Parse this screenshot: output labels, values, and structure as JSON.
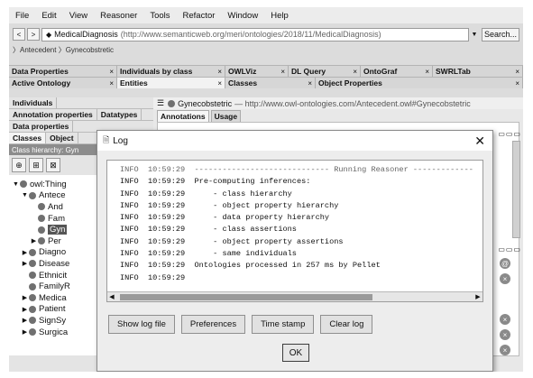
{
  "menubar": [
    "File",
    "Edit",
    "View",
    "Reasoner",
    "Tools",
    "Refactor",
    "Window",
    "Help"
  ],
  "address": {
    "back": "<",
    "forward": ">",
    "ontology_name": "MedicalDiagnosis",
    "ontology_uri": "(http://www.semanticweb.org/meri/ontologies/2018/11/MedicalDiagnosis)",
    "dropdown": "▼",
    "search_label": "Search..."
  },
  "breadcrumb": "〉Antecedent 〉Gynecobstretic",
  "tabs_row1": [
    {
      "label": "Data Properties",
      "close": "×"
    },
    {
      "label": "Individuals by class",
      "close": "×"
    },
    {
      "label": "OWLViz",
      "close": "×"
    },
    {
      "label": "DL Query",
      "close": "×"
    },
    {
      "label": "OntoGraf",
      "close": "×"
    },
    {
      "label": "SWRLTab",
      "close": "×"
    }
  ],
  "tabs_row2": [
    {
      "label": "Active Ontology",
      "close": "×"
    },
    {
      "label": "Entities",
      "close": "×"
    },
    {
      "label": "Classes",
      "close": "×"
    },
    {
      "label": "Object Properties",
      "close": "×"
    }
  ],
  "left": {
    "row1": [
      "Individuals"
    ],
    "row2": [
      "Annotation properties",
      "Datatypes"
    ],
    "row3": [
      "Data properties"
    ],
    "row4": [
      "Classes",
      "Object"
    ],
    "hierarchy_label": "Class hierarchy: Gyn",
    "tree": [
      {
        "toggle": "▼",
        "label": "owl:Thing",
        "indent": 0
      },
      {
        "toggle": "▼",
        "label": "Antece",
        "indent": 1
      },
      {
        "toggle": "",
        "label": "And",
        "indent": 2
      },
      {
        "toggle": "",
        "label": "Fam",
        "indent": 2
      },
      {
        "toggle": "",
        "label": "Gyn",
        "indent": 2,
        "selected": true
      },
      {
        "toggle": "▶",
        "label": "Per",
        "indent": 2
      },
      {
        "toggle": "▶",
        "label": "Diagno",
        "indent": 1
      },
      {
        "toggle": "▶",
        "label": "Disease",
        "indent": 1
      },
      {
        "toggle": "",
        "label": "Ethnicit",
        "indent": 1
      },
      {
        "toggle": "",
        "label": "FamilyR",
        "indent": 1
      },
      {
        "toggle": "▶",
        "label": "Medica",
        "indent": 1
      },
      {
        "toggle": "▶",
        "label": "Patient",
        "indent": 1
      },
      {
        "toggle": "▶",
        "label": "SignSy",
        "indent": 1
      },
      {
        "toggle": "▶",
        "label": "Surgica",
        "indent": 1
      }
    ]
  },
  "entity": {
    "name": "Gynecobstetric",
    "uri": "— http://www.owl-ontologies.com/Antecedent.owl#Gynecobstetric",
    "tabs": [
      "Annotations",
      "Usage"
    ]
  },
  "dialog": {
    "title": "Log",
    "close": "✕",
    "log_lines": [
      "INFO  10:59:29  ----------------------------- Running Reasoner -------------",
      "INFO  10:59:29  Pre-computing inferences:",
      "INFO  10:59:29      - class hierarchy",
      "INFO  10:59:29      - object property hierarchy",
      "INFO  10:59:29      - data property hierarchy",
      "INFO  10:59:29      - class assertions",
      "INFO  10:59:29      - object property assertions",
      "INFO  10:59:29      - same individuals",
      "INFO  10:59:29  Ontologies processed in 257 ms by Pellet",
      "INFO  10:59:29"
    ],
    "buttons": [
      "Show log file",
      "Preferences",
      "Time stamp",
      "Clear log"
    ],
    "ok_label": "OK"
  }
}
